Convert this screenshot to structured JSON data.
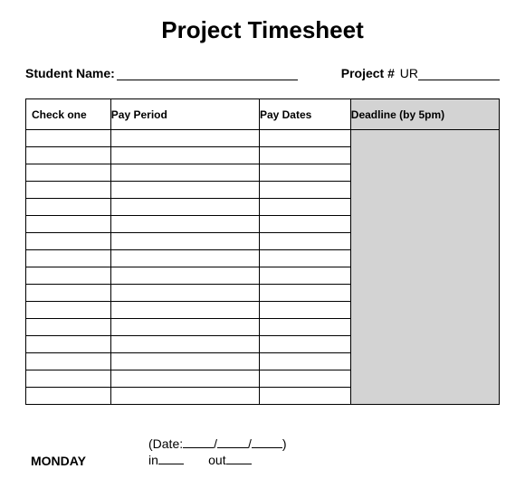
{
  "title": "Project Timesheet",
  "student_name_label": "Student Name:",
  "project_label": "Project #",
  "project_prefix": "UR",
  "headers": {
    "check": "Check one",
    "period": "Pay Period",
    "dates": "Pay Dates",
    "deadline": "Deadline (by 5pm)"
  },
  "row_count": 16,
  "day": {
    "name": "MONDAY",
    "date_label": "(Date:",
    "in_label": "in",
    "out_label": "out"
  }
}
